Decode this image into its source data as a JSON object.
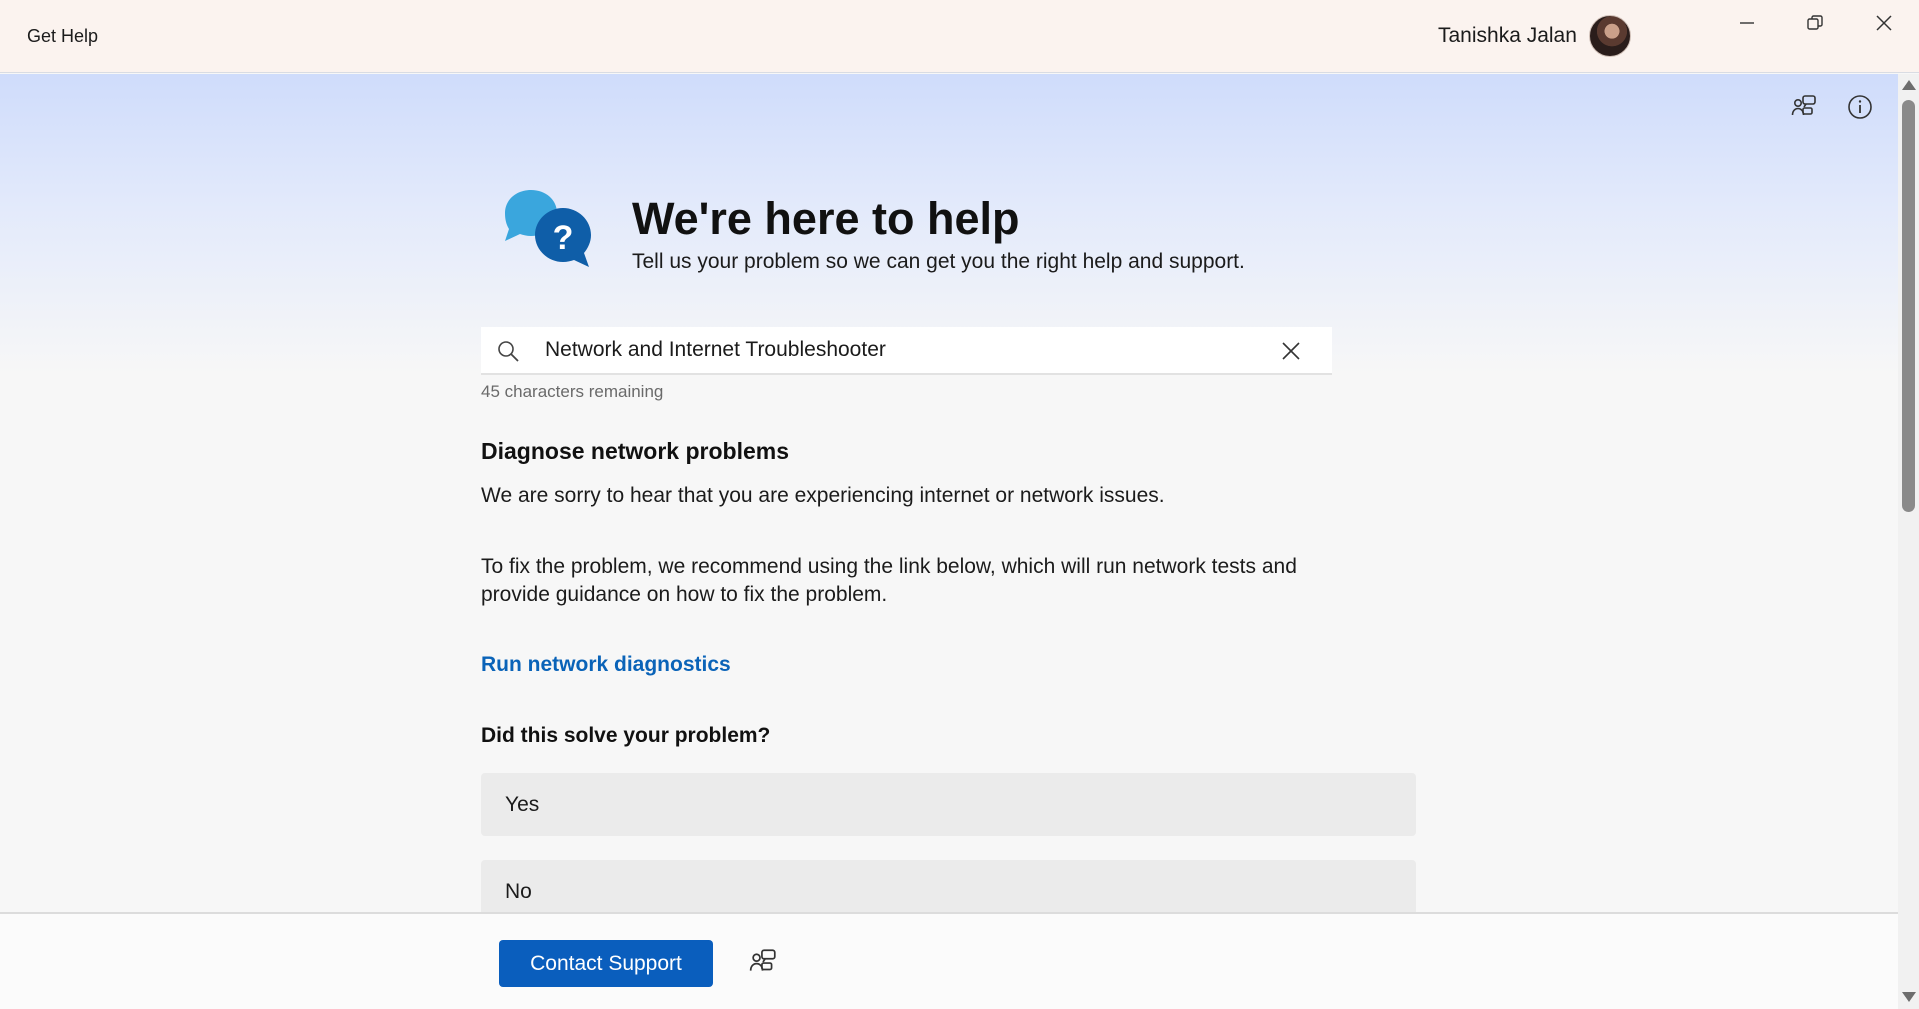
{
  "window": {
    "title": "Get Help",
    "user_name": "Tanishka Jalan"
  },
  "icons": {
    "minimize": "minimize-icon",
    "maximize": "maximize-icon",
    "close": "close-icon",
    "chat": "chat-support-icon",
    "info": "info-icon",
    "hero": "help-chat-bubble-icon",
    "search": "search-icon",
    "clear": "clear-icon"
  },
  "hero": {
    "title": "We're here to help",
    "subtitle": "Tell us your problem so we can get you the right help and support."
  },
  "search": {
    "value": "Network and Internet Troubleshooter",
    "chars_remaining": "45 characters remaining"
  },
  "content": {
    "section_title": "Diagnose network problems",
    "para1": "We are sorry to hear that you are experiencing internet or network issues.",
    "para2": "To fix the problem, we recommend using the link below, which will run network tests and provide guidance on how to fix the problem.",
    "link": "Run network diagnostics",
    "question": "Did this solve your problem?",
    "options": [
      "Yes",
      "No"
    ]
  },
  "footer": {
    "contact_label": "Contact Support"
  },
  "colors": {
    "accent": "#0a5ebd",
    "link": "#0a63b8",
    "titlebar": "#fbf3ef"
  }
}
